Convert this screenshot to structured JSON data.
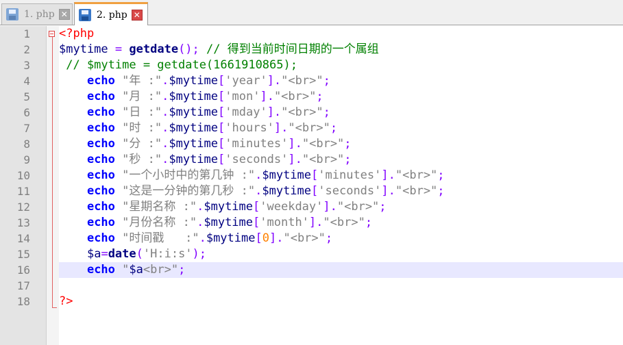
{
  "tabs": [
    {
      "label": "1. php",
      "active": false
    },
    {
      "label": "2. php",
      "active": true
    }
  ],
  "line_numbers": [
    "1",
    "2",
    "3",
    "4",
    "5",
    "6",
    "7",
    "8",
    "9",
    "10",
    "11",
    "12",
    "13",
    "14",
    "15",
    "16",
    "17",
    "18"
  ],
  "colors": {
    "keyword": "#0000ff",
    "variable": "#000080",
    "comment": "#008000",
    "string": "#808080",
    "operator": "#8000ff",
    "tag": "#ff0000",
    "number": "#ff8000",
    "current_line": "#e8e8ff"
  },
  "lines": [
    [
      [
        "tag",
        "<?php"
      ]
    ],
    [
      [
        "var",
        "$mytime"
      ],
      [
        "plain",
        " "
      ],
      [
        "op",
        "="
      ],
      [
        "plain",
        " "
      ],
      [
        "fn",
        "getdate"
      ],
      [
        "op",
        "();"
      ],
      [
        "plain",
        " "
      ],
      [
        "cm",
        "// 得到当前时间日期的一个属组"
      ]
    ],
    [
      [
        "cm",
        " // $mytime = getdate(1661910865);"
      ]
    ],
    [
      [
        "plain",
        "    "
      ],
      [
        "kw",
        "echo"
      ],
      [
        "plain",
        " "
      ],
      [
        "str",
        "\"年 :\""
      ],
      [
        "op",
        "."
      ],
      [
        "var",
        "$mytime"
      ],
      [
        "op",
        "["
      ],
      [
        "str",
        "'year'"
      ],
      [
        "op",
        "]."
      ],
      [
        "str",
        "\"<br>\""
      ],
      [
        "op",
        ";"
      ]
    ],
    [
      [
        "plain",
        "    "
      ],
      [
        "kw",
        "echo"
      ],
      [
        "plain",
        " "
      ],
      [
        "str",
        "\"月 :\""
      ],
      [
        "op",
        "."
      ],
      [
        "var",
        "$mytime"
      ],
      [
        "op",
        "["
      ],
      [
        "str",
        "'mon'"
      ],
      [
        "op",
        "]."
      ],
      [
        "str",
        "\"<br>\""
      ],
      [
        "op",
        ";"
      ]
    ],
    [
      [
        "plain",
        "    "
      ],
      [
        "kw",
        "echo"
      ],
      [
        "plain",
        " "
      ],
      [
        "str",
        "\"日 :\""
      ],
      [
        "op",
        "."
      ],
      [
        "var",
        "$mytime"
      ],
      [
        "op",
        "["
      ],
      [
        "str",
        "'mday'"
      ],
      [
        "op",
        "]."
      ],
      [
        "str",
        "\"<br>\""
      ],
      [
        "op",
        ";"
      ]
    ],
    [
      [
        "plain",
        "    "
      ],
      [
        "kw",
        "echo"
      ],
      [
        "plain",
        " "
      ],
      [
        "str",
        "\"时 :\""
      ],
      [
        "op",
        "."
      ],
      [
        "var",
        "$mytime"
      ],
      [
        "op",
        "["
      ],
      [
        "str",
        "'hours'"
      ],
      [
        "op",
        "]."
      ],
      [
        "str",
        "\"<br>\""
      ],
      [
        "op",
        ";"
      ]
    ],
    [
      [
        "plain",
        "    "
      ],
      [
        "kw",
        "echo"
      ],
      [
        "plain",
        " "
      ],
      [
        "str",
        "\"分 :\""
      ],
      [
        "op",
        "."
      ],
      [
        "var",
        "$mytime"
      ],
      [
        "op",
        "["
      ],
      [
        "str",
        "'minutes'"
      ],
      [
        "op",
        "]."
      ],
      [
        "str",
        "\"<br>\""
      ],
      [
        "op",
        ";"
      ]
    ],
    [
      [
        "plain",
        "    "
      ],
      [
        "kw",
        "echo"
      ],
      [
        "plain",
        " "
      ],
      [
        "str",
        "\"秒 :\""
      ],
      [
        "op",
        "."
      ],
      [
        "var",
        "$mytime"
      ],
      [
        "op",
        "["
      ],
      [
        "str",
        "'seconds'"
      ],
      [
        "op",
        "]."
      ],
      [
        "str",
        "\"<br>\""
      ],
      [
        "op",
        ";"
      ]
    ],
    [
      [
        "plain",
        "    "
      ],
      [
        "kw",
        "echo"
      ],
      [
        "plain",
        " "
      ],
      [
        "str",
        "\"一个小时中的第几钟 :\""
      ],
      [
        "op",
        "."
      ],
      [
        "var",
        "$mytime"
      ],
      [
        "op",
        "["
      ],
      [
        "str",
        "'minutes'"
      ],
      [
        "op",
        "]."
      ],
      [
        "str",
        "\"<br>\""
      ],
      [
        "op",
        ";"
      ]
    ],
    [
      [
        "plain",
        "    "
      ],
      [
        "kw",
        "echo"
      ],
      [
        "plain",
        " "
      ],
      [
        "str",
        "\"这是一分钟的第几秒 :\""
      ],
      [
        "op",
        "."
      ],
      [
        "var",
        "$mytime"
      ],
      [
        "op",
        "["
      ],
      [
        "str",
        "'seconds'"
      ],
      [
        "op",
        "]."
      ],
      [
        "str",
        "\"<br>\""
      ],
      [
        "op",
        ";"
      ]
    ],
    [
      [
        "plain",
        "    "
      ],
      [
        "kw",
        "echo"
      ],
      [
        "plain",
        " "
      ],
      [
        "str",
        "\"星期名称 :\""
      ],
      [
        "op",
        "."
      ],
      [
        "var",
        "$mytime"
      ],
      [
        "op",
        "["
      ],
      [
        "str",
        "'weekday'"
      ],
      [
        "op",
        "]."
      ],
      [
        "str",
        "\"<br>\""
      ],
      [
        "op",
        ";"
      ]
    ],
    [
      [
        "plain",
        "    "
      ],
      [
        "kw",
        "echo"
      ],
      [
        "plain",
        " "
      ],
      [
        "str",
        "\"月份名称 :\""
      ],
      [
        "op",
        "."
      ],
      [
        "var",
        "$mytime"
      ],
      [
        "op",
        "["
      ],
      [
        "str",
        "'month'"
      ],
      [
        "op",
        "]."
      ],
      [
        "str",
        "\"<br>\""
      ],
      [
        "op",
        ";"
      ]
    ],
    [
      [
        "plain",
        "    "
      ],
      [
        "kw",
        "echo"
      ],
      [
        "plain",
        " "
      ],
      [
        "str",
        "\"时间戳   :\""
      ],
      [
        "op",
        "."
      ],
      [
        "var",
        "$mytime"
      ],
      [
        "op",
        "["
      ],
      [
        "num",
        "0"
      ],
      [
        "op",
        "]."
      ],
      [
        "str",
        "\"<br>\""
      ],
      [
        "op",
        ";"
      ]
    ],
    [
      [
        "plain",
        "    "
      ],
      [
        "var",
        "$a"
      ],
      [
        "op",
        "="
      ],
      [
        "fn",
        "date"
      ],
      [
        "op",
        "("
      ],
      [
        "str",
        "'H:i:s'"
      ],
      [
        "op",
        ");"
      ]
    ],
    [
      [
        "plain",
        "    "
      ],
      [
        "kw",
        "echo"
      ],
      [
        "plain",
        " "
      ],
      [
        "str",
        "\""
      ],
      [
        "var",
        "$a"
      ],
      [
        "str",
        "<br>\""
      ],
      [
        "op",
        ";"
      ]
    ],
    [],
    [
      [
        "tag",
        "?>"
      ]
    ]
  ],
  "current_line_index": 15
}
